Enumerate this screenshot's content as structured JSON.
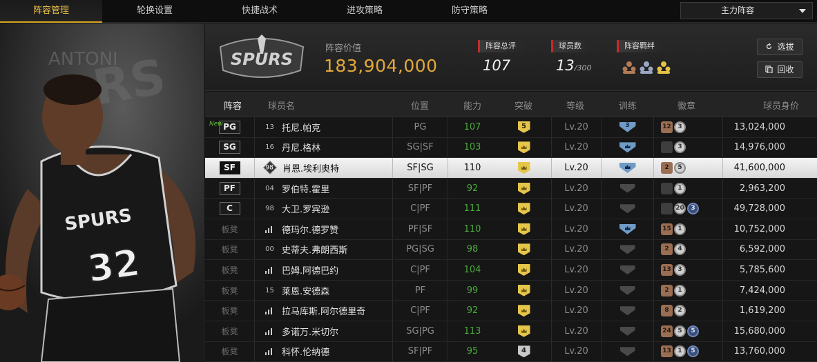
{
  "nav": {
    "tabs": [
      "阵容管理",
      "轮换设置",
      "快捷战术",
      "进攻策略",
      "防守策略"
    ],
    "active_tab": "阵容管理",
    "lineup_select": "主力阵容"
  },
  "team": {
    "logo_text": "SPURS",
    "value_label": "阵容价值",
    "value": "183,904,000",
    "overall_label": "阵容总评",
    "overall": "107",
    "players_label": "球员数",
    "players_count": "13",
    "players_max": "/300",
    "chemistry_label": "阵容羁绊",
    "pick_button": "选拔",
    "back_button": "回收"
  },
  "table": {
    "headers": {
      "lineup": "阵容",
      "name": "球员名",
      "position": "位置",
      "ability": "能力",
      "breakthrough": "突破",
      "level": "等级",
      "training": "训练",
      "badges": "徽章",
      "price": "球员身价"
    },
    "rows": [
      {
        "lineup": "PG",
        "new": "New",
        "jersey": "13",
        "name": "托尼.帕克",
        "position": "PG",
        "ability": "107",
        "break": "5",
        "level": "Lv.20",
        "train": "3",
        "badges": [
          "12",
          "3"
        ],
        "price": "13,024,000"
      },
      {
        "lineup": "SG",
        "jersey": "16",
        "name": "丹尼.格林",
        "position": "SG|SF",
        "ability": "103",
        "break": "",
        "level": "Lv.20",
        "train": "",
        "badges": [
          "",
          "3"
        ],
        "price": "14,976,000"
      },
      {
        "lineup": "SF",
        "jersey": "98",
        "name": "肖恩.埃利奥特",
        "position": "SF|SG",
        "ability": "110",
        "break": "",
        "level": "Lv.20",
        "train": "",
        "badges": [
          "2",
          "5"
        ],
        "price": "41,600,000"
      },
      {
        "lineup": "PF",
        "jersey": "04",
        "name": "罗伯特.霍里",
        "position": "SF|PF",
        "ability": "92",
        "break": "",
        "level": "Lv.20",
        "train": "",
        "badges": [
          "",
          "1"
        ],
        "price": "2,963,200"
      },
      {
        "lineup": "C",
        "jersey": "98",
        "name": "大卫.罗宾逊",
        "position": "C|PF",
        "ability": "111",
        "break": "",
        "level": "Lv.20",
        "train": "",
        "badges": [
          "",
          "20",
          "3"
        ],
        "price": "49,728,000"
      },
      {
        "lineup": "板凳",
        "jersey": "",
        "name": "德玛尔.德罗赞",
        "position": "PF|SF",
        "ability": "110",
        "break": "",
        "level": "Lv.20",
        "train": "",
        "badges": [
          "15",
          "1"
        ],
        "price": "10,752,000"
      },
      {
        "lineup": "板凳",
        "jersey": "00",
        "name": "史蒂夫.弗朗西斯",
        "position": "PG|SG",
        "ability": "98",
        "break": "",
        "level": "Lv.20",
        "train": "",
        "badges": [
          "2",
          "4"
        ],
        "price": "6,592,000"
      },
      {
        "lineup": "板凳",
        "jersey": "",
        "name": "巴姆.阿德巴约",
        "position": "C|PF",
        "ability": "104",
        "break": "",
        "level": "Lv.20",
        "train": "",
        "badges": [
          "13",
          "3"
        ],
        "price": "5,785,600"
      },
      {
        "lineup": "板凳",
        "jersey": "15",
        "name": "莱恩.安德森",
        "position": "PF",
        "ability": "99",
        "break": "",
        "level": "Lv.20",
        "train": "",
        "badges": [
          "2",
          "1"
        ],
        "price": "7,424,000"
      },
      {
        "lineup": "板凳",
        "jersey": "",
        "name": "拉马库斯.阿尔德里奇",
        "position": "C|PF",
        "ability": "92",
        "break": "",
        "level": "Lv.20",
        "train": "",
        "badges": [
          "8",
          "2"
        ],
        "price": "1,619,200"
      },
      {
        "lineup": "板凳",
        "jersey": "",
        "name": "多诺万.米切尔",
        "position": "SG|PG",
        "ability": "113",
        "break": "",
        "level": "Lv.20",
        "train": "",
        "badges": [
          "24",
          "5",
          "5"
        ],
        "price": "15,680,000"
      },
      {
        "lineup": "板凳",
        "jersey": "",
        "name": "科怀.伦纳德",
        "position": "SF|PF",
        "ability": "95",
        "break": "4",
        "level": "Lv.20",
        "train": "",
        "badges": [
          "13",
          "1",
          "5"
        ],
        "price": "13,760,000"
      }
    ]
  },
  "hero": {
    "jersey_text": "SPURS",
    "jersey_number": "32"
  },
  "colors": {
    "accent": "#e3a93b",
    "ability_green": "#4aa93d",
    "gold_shield": "#e6c64a",
    "train_blue": "#6f9bc6"
  }
}
